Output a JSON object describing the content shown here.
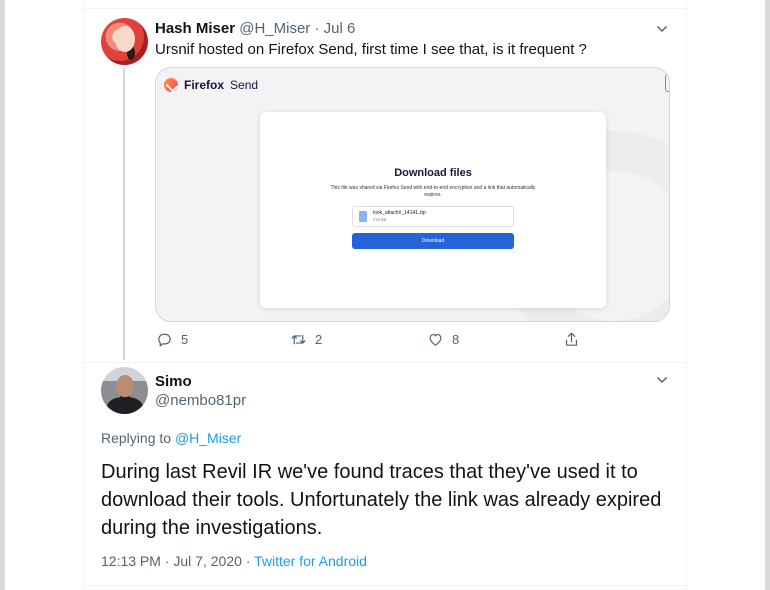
{
  "tweet1": {
    "name": "Hash Miser",
    "handle": "@H_Miser",
    "separator": "·",
    "date": "Jul 6",
    "text": "Ursnif hosted on Firefox Send, first time I see that, is it frequent ?",
    "card": {
      "logo_brand": "Firefox",
      "logo_product": "Send",
      "modal_title": "Download files",
      "modal_desc": "This file was shared via Firefox Send with end-to-end encryption and a link that automatically expires.",
      "file_name": "look_attach#_14141.zip",
      "file_size": "275 KB",
      "button_label": "Download"
    },
    "actions": {
      "replies": "5",
      "retweets": "2",
      "likes": "8"
    }
  },
  "tweet2": {
    "name": "Simo",
    "handle": "@nembo81pr",
    "replying_prefix": "Replying to",
    "replying_mention": "@H_Miser",
    "text": "During last Revil IR we've found traces that they've used it to download their tools. Unfortunately the link was already expired during the investigations.",
    "time": "12:13 PM",
    "separator1": "·",
    "date": "Jul 7, 2020",
    "separator2": "·",
    "source": "Twitter for Android"
  },
  "colors": {
    "text": "#0f1419",
    "secondary": "#536471",
    "accent": "#1d9bf0",
    "border": "#cfd9de",
    "download_button": "#2563d9"
  },
  "icons": [
    "chevron-down-icon",
    "reply-icon",
    "retweet-icon",
    "like-icon",
    "share-icon",
    "firefox-send-logo"
  ]
}
